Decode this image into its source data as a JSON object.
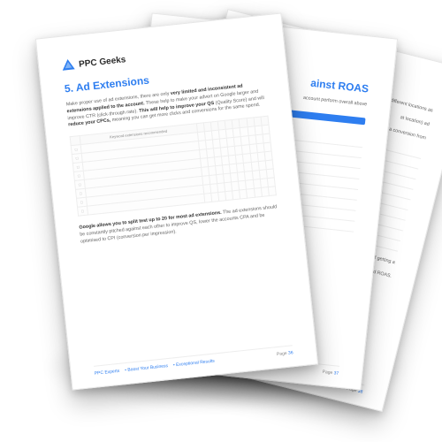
{
  "brand": "PPC Geeks",
  "front": {
    "heading": "5. Ad Extensions",
    "p1_a": "Make proper use of ad extensions, there are only ",
    "p1_b": "very limited and inconsistent ad extensions applied to the account.",
    "p1_c": " These help to make your advert on Google larger and improve CTR (click-through rate). ",
    "p1_d": "This will help to improve your QS",
    "p1_e": " (Quality Score) and will ",
    "p1_f": "reduce your CPCs,",
    "p1_g": " meaning you can get more clicks and conversions for the same spend.",
    "p2_a": "Google allows you to split test up to 20 for most ad extensions.",
    "p2_b": " The ad extensions should be constantly pitched against each other to improve QS, lower the accounts CPA and be optimised to CPI (conversion per impression).",
    "table_headers": [
      "",
      "Keyword extensions recommended",
      "",
      "",
      "",
      "",
      "",
      "",
      "",
      "",
      "",
      ""
    ],
    "table_rows": [
      [
        "□",
        "",
        "",
        "",
        "",
        "",
        "",
        "",
        "",
        "",
        "",
        ""
      ],
      [
        "□",
        "",
        "",
        "",
        "",
        "",
        "",
        "",
        "",
        "",
        "",
        ""
      ],
      [
        "□",
        "",
        "",
        "",
        "",
        "",
        "",
        "",
        "",
        "",
        "",
        ""
      ],
      [
        "□",
        "",
        "",
        "",
        "",
        "",
        "",
        "",
        "",
        "",
        "",
        ""
      ],
      [
        "□",
        "",
        "",
        "",
        "",
        "",
        "",
        "",
        "",
        "",
        "",
        ""
      ],
      [
        "□",
        "",
        "",
        "",
        "",
        "",
        "",
        "",
        "",
        "",
        "",
        ""
      ],
      [
        "□",
        "",
        "",
        "",
        "",
        "",
        "",
        "",
        "",
        "",
        "",
        ""
      ],
      [
        "□",
        "",
        "",
        "",
        "",
        "",
        "",
        "",
        "",
        "",
        "",
        ""
      ]
    ]
  },
  "mid": {
    "heading_partial": "ainst ROAS",
    "p1": "account perform overall above",
    "table_rows": [
      [
        "",
        ""
      ],
      [
        "",
        ""
      ],
      [
        "",
        ""
      ],
      [
        "",
        ""
      ],
      [
        "",
        ""
      ],
      [
        "",
        ""
      ],
      [
        "",
        ""
      ],
      [
        "",
        ""
      ],
      [
        "",
        ""
      ]
    ]
  },
  "back": {
    "p1": "different locations as",
    "p2": "at location) ad",
    "p3": "king a conversion from",
    "p4": "ist of getting a",
    "p5": "nd ROAS.",
    "table_rows": [
      [
        "",
        "",
        "",
        ""
      ],
      [
        "",
        "",
        "",
        ""
      ],
      [
        "",
        "",
        "",
        ""
      ],
      [
        "",
        "",
        "",
        ""
      ],
      [
        "",
        "",
        "",
        ""
      ],
      [
        "",
        "",
        "",
        ""
      ],
      [
        "",
        "",
        "",
        ""
      ],
      [
        "",
        "",
        "",
        ""
      ],
      [
        "",
        "",
        "",
        ""
      ],
      [
        "",
        "",
        "",
        ""
      ]
    ]
  },
  "footer": {
    "b1": "PPC Experts",
    "b2": "Boost Your Business",
    "b3": "Exceptional Results",
    "page_label": "Page ",
    "front_no": "36",
    "mid_no": "37",
    "back_no": "38"
  }
}
